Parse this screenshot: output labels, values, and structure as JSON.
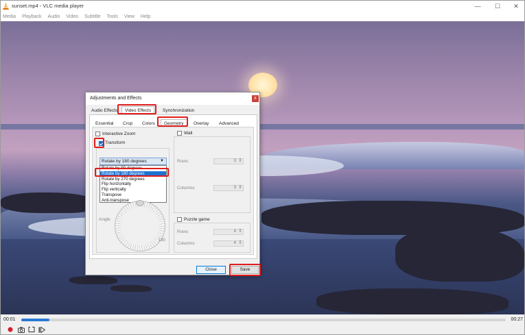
{
  "window": {
    "title": "sunset.mp4 - VLC media player",
    "minimize": "—",
    "maximize": "☐",
    "close": "✕"
  },
  "menu": [
    "Media",
    "Playback",
    "Audio",
    "Video",
    "Subtitle",
    "Tools",
    "View",
    "Help"
  ],
  "player": {
    "time_current": "00:01",
    "time_total": "00:27",
    "progress_fraction": 0.058
  },
  "dialog": {
    "title": "Adjustments and Effects",
    "close_glyph": "x",
    "top_tabs": [
      "Audio Effects",
      "Video Effects",
      "Synchronization"
    ],
    "active_top_tab": "Video Effects",
    "sub_tabs": [
      "Essential",
      "Crop",
      "Colors",
      "Geometry",
      "Overlay",
      "Advanced"
    ],
    "active_sub_tab": "Geometry",
    "interactive_zoom_label": "Interactive Zoom",
    "transform_label": "Transform",
    "transform_checked": true,
    "transform_selected": "Rotate by 180 degrees",
    "transform_options": [
      "Rotate by 90 degrees",
      "Rotate by 180 degrees",
      "Rotate by 270 degrees",
      "Flip horizontally",
      "Flip vertically",
      "Transpose",
      "Anti-transpose"
    ],
    "angle_label": "Angle",
    "angle_value": "180",
    "wall_label": "Wall",
    "wall_rows_label": "Rows",
    "wall_rows_value": "3",
    "wall_columns_label": "Columns",
    "wall_columns_value": "3",
    "puzzle_label": "Puzzle game",
    "puzzle_rows_label": "Rows",
    "puzzle_rows_value": "4",
    "puzzle_columns_label": "Columns",
    "puzzle_columns_value": "4",
    "close_button": "Close",
    "save_button": "Save"
  },
  "colors": {
    "accent": "#1e73d2",
    "highlight": "#e11b1b",
    "progress": "#2b7ad6"
  }
}
